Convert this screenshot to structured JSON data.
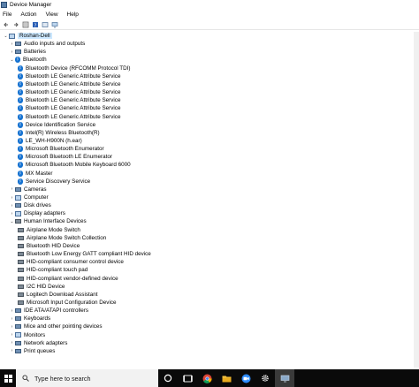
{
  "window": {
    "title": "Device Manager"
  },
  "menu": [
    "File",
    "Action",
    "View",
    "Help"
  ],
  "tree": {
    "root": "Roshan-Dell",
    "categories_top": [
      "Audio inputs and outputs",
      "Batteries"
    ],
    "bluetooth": {
      "label": "Bluetooth",
      "items": [
        "Bluetooth Device (RFCOMM Protocol TDI)",
        "Bluetooth LE Generic Attribute Service",
        "Bluetooth LE Generic Attribute Service",
        "Bluetooth LE Generic Attribute Service",
        "Bluetooth LE Generic Attribute Service",
        "Bluetooth LE Generic Attribute Service",
        "Bluetooth LE Generic Attribute Service",
        "Device Identification Service",
        "Intel(R) Wireless Bluetooth(R)",
        "LE_WH-H900N (h.ear)",
        "Microsoft Bluetooth Enumerator",
        "Microsoft Bluetooth LE Enumerator",
        "Microsoft Bluetooth Mobile Keyboard 6000",
        "MX Master",
        "Service Discovery Service"
      ]
    },
    "categories_mid": [
      "Cameras",
      "Computer",
      "Disk drives",
      "Display adapters"
    ],
    "hid": {
      "label": "Human Interface Devices",
      "items": [
        "Airplane Mode Switch",
        "Airplane Mode Switch Collection",
        "Bluetooth HID Device",
        "Bluetooth Low Energy GATT compliant HID device",
        "HID-compliant consumer control device",
        "HID-compliant touch pad",
        "HID-compliant vendor-defined device",
        "I2C HID Device",
        "Logitech Download Assistant",
        "Microsoft Input Configuration Device"
      ]
    },
    "categories_bottom": [
      "IDE ATA/ATAPI controllers",
      "Keyboards",
      "Mice and other pointing devices",
      "Monitors",
      "Network adapters",
      "Print queues"
    ]
  },
  "taskbar": {
    "search_placeholder": "Type here to search"
  },
  "colors": {
    "accent": "#1572d1",
    "selection": "#cce8ff",
    "taskbar": "#0a0a0a"
  }
}
